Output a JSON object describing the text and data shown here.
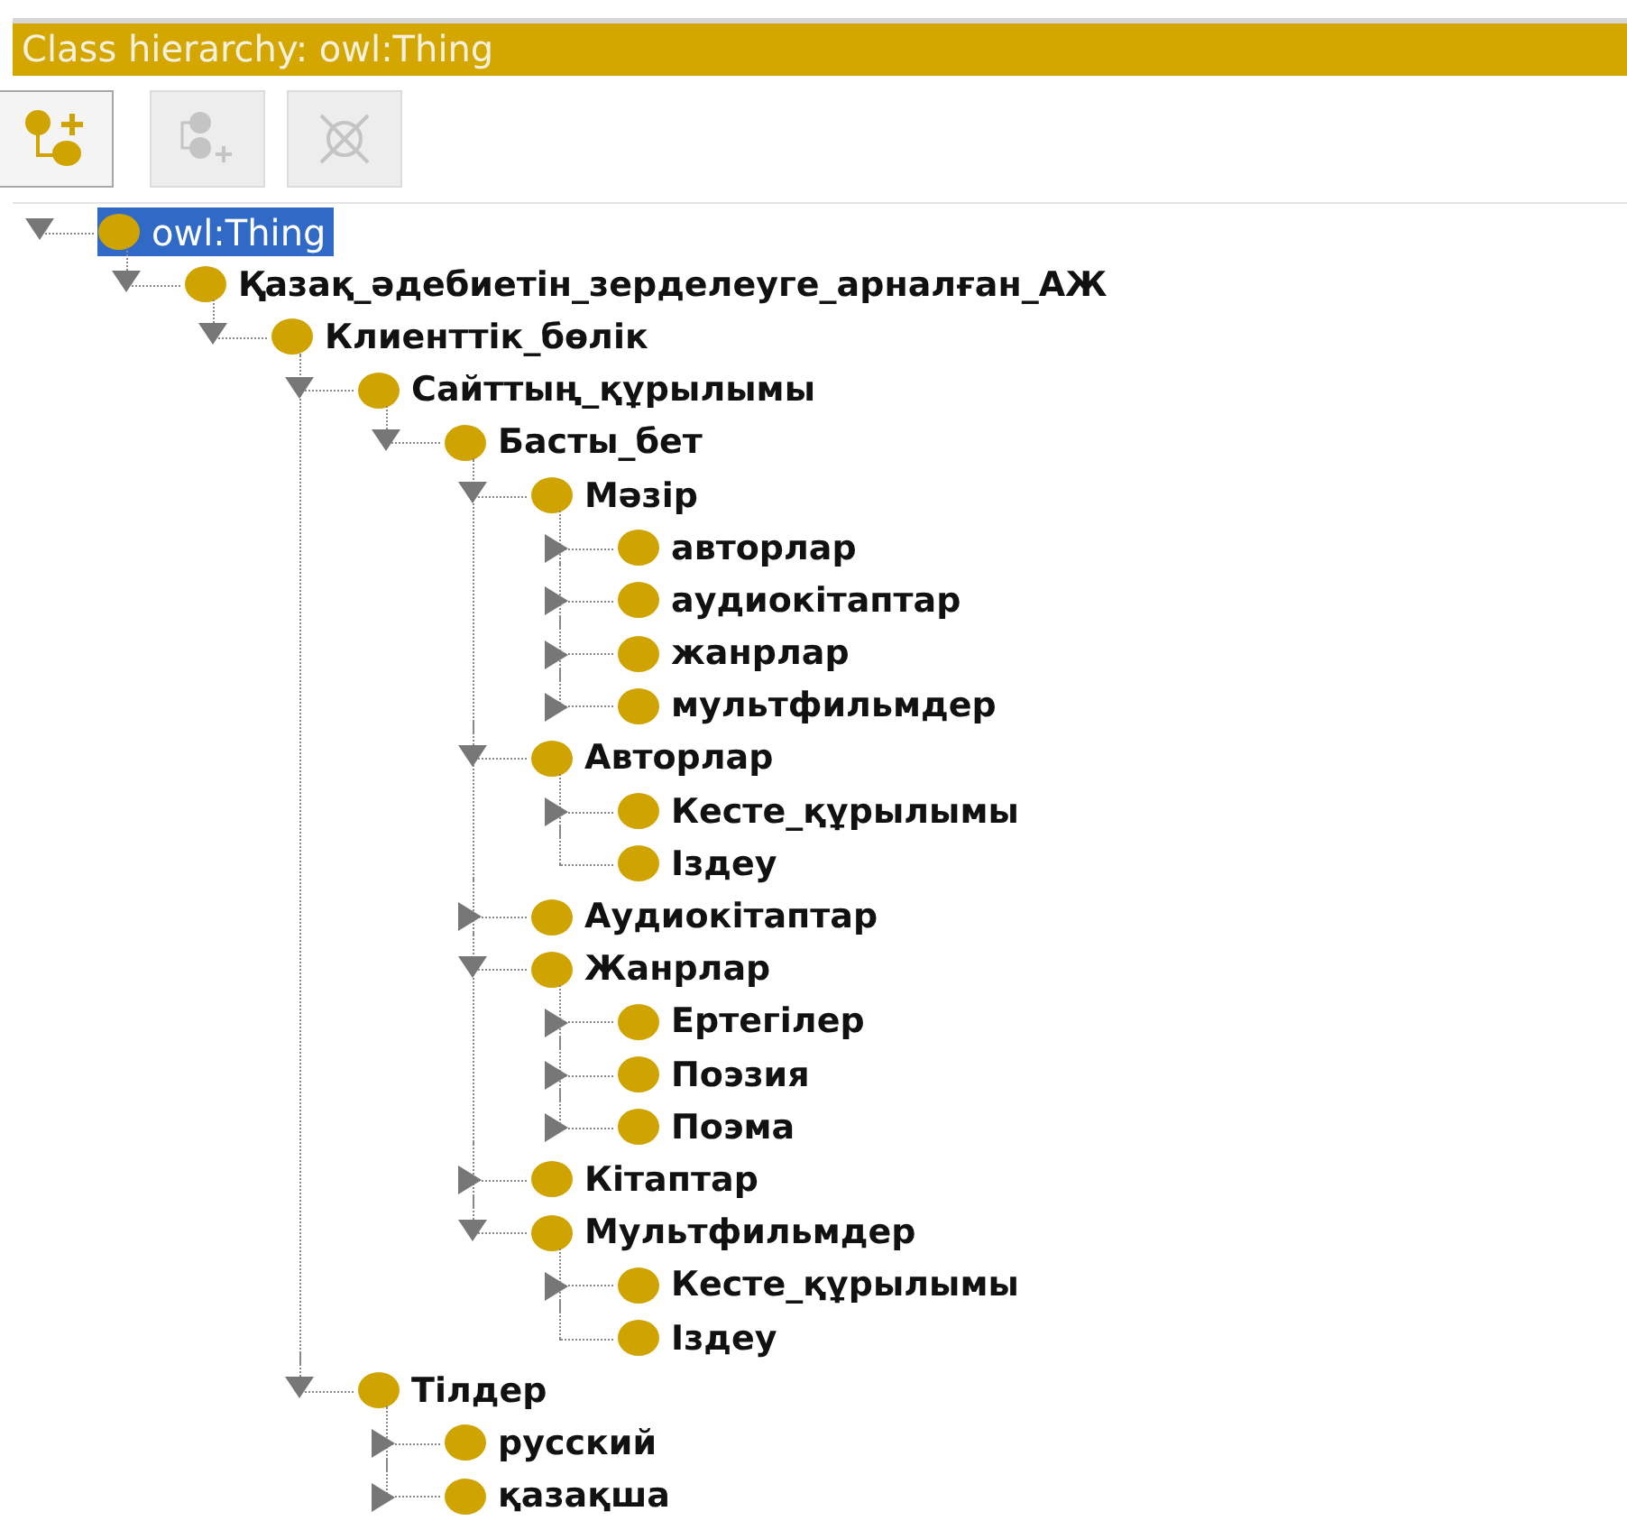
{
  "panel": {
    "title": "Class hierarchy: owl:Thing"
  },
  "toolbar": [
    {
      "kind": "add-subclass",
      "disabled": false
    },
    {
      "kind": "add-sibling",
      "disabled": true
    },
    {
      "kind": "delete",
      "disabled": true
    }
  ],
  "tree": {
    "root": {
      "label": "owl:Thing",
      "selected": true,
      "expanded": true,
      "children": [
        {
          "label": "Қазақ_әдебиетін_зерделеуге_арналған_АЖ",
          "kind": "branch",
          "selected": false,
          "expanded": true,
          "children": [
            {
              "label": "Клиенттік_бөлік",
              "kind": "branch",
              "selected": false,
              "expanded": true,
              "children": [
                {
                  "label": "Сайттың_құрылымы",
                  "kind": "branch",
                  "selected": false,
                  "expanded": true,
                  "children": [
                    {
                      "label": "Басты_бет",
                      "kind": "branch",
                      "selected": false,
                      "expanded": true,
                      "children": [
                        {
                          "label": "Мәзір",
                          "kind": "branch",
                          "selected": false,
                          "expanded": true,
                          "children": [
                            {
                              "label": "авторлар",
                              "kind": "branch",
                              "selected": false,
                              "expanded": false
                            },
                            {
                              "label": "аудиокітаптар",
                              "kind": "branch",
                              "selected": false,
                              "expanded": false
                            },
                            {
                              "label": "жанрлар",
                              "kind": "branch",
                              "selected": false,
                              "expanded": false
                            },
                            {
                              "label": "мультфильмдер",
                              "kind": "branch",
                              "selected": false,
                              "expanded": false
                            }
                          ]
                        },
                        {
                          "label": "Авторлар",
                          "kind": "branch",
                          "selected": false,
                          "expanded": true,
                          "children": [
                            {
                              "label": "Кесте_құрылымы",
                              "kind": "branch",
                              "selected": false,
                              "expanded": false
                            },
                            {
                              "label": "Іздеу",
                              "kind": "leaf",
                              "selected": false
                            }
                          ]
                        },
                        {
                          "label": "Аудиокітаптар",
                          "kind": "branch",
                          "selected": false,
                          "expanded": false
                        },
                        {
                          "label": "Жанрлар",
                          "kind": "branch",
                          "selected": false,
                          "expanded": true,
                          "children": [
                            {
                              "label": "Ертегілер",
                              "kind": "branch",
                              "selected": false,
                              "expanded": false
                            },
                            {
                              "label": "Поэзия",
                              "kind": "branch",
                              "selected": false,
                              "expanded": false
                            },
                            {
                              "label": "Поэма",
                              "kind": "branch",
                              "selected": false,
                              "expanded": false
                            }
                          ]
                        },
                        {
                          "label": "Кітаптар",
                          "kind": "branch",
                          "selected": false,
                          "expanded": false
                        },
                        {
                          "label": "Мультфильмдер",
                          "kind": "branch",
                          "selected": false,
                          "expanded": true,
                          "children": [
                            {
                              "label": "Кесте_құрылымы",
                              "kind": "branch",
                              "selected": false,
                              "expanded": false
                            },
                            {
                              "label": "Іздеу",
                              "kind": "leaf",
                              "selected": false
                            }
                          ]
                        }
                      ]
                    }
                  ]
                },
                {
                  "label": "Тілдер",
                  "kind": "branch",
                  "selected": false,
                  "expanded": true,
                  "children": [
                    {
                      "label": "русский",
                      "kind": "branch",
                      "selected": false,
                      "expanded": false
                    },
                    {
                      "label": "қазақша",
                      "kind": "branch",
                      "selected": false,
                      "expanded": false
                    }
                  ]
                }
              ]
            }
          ]
        }
      ]
    }
  }
}
